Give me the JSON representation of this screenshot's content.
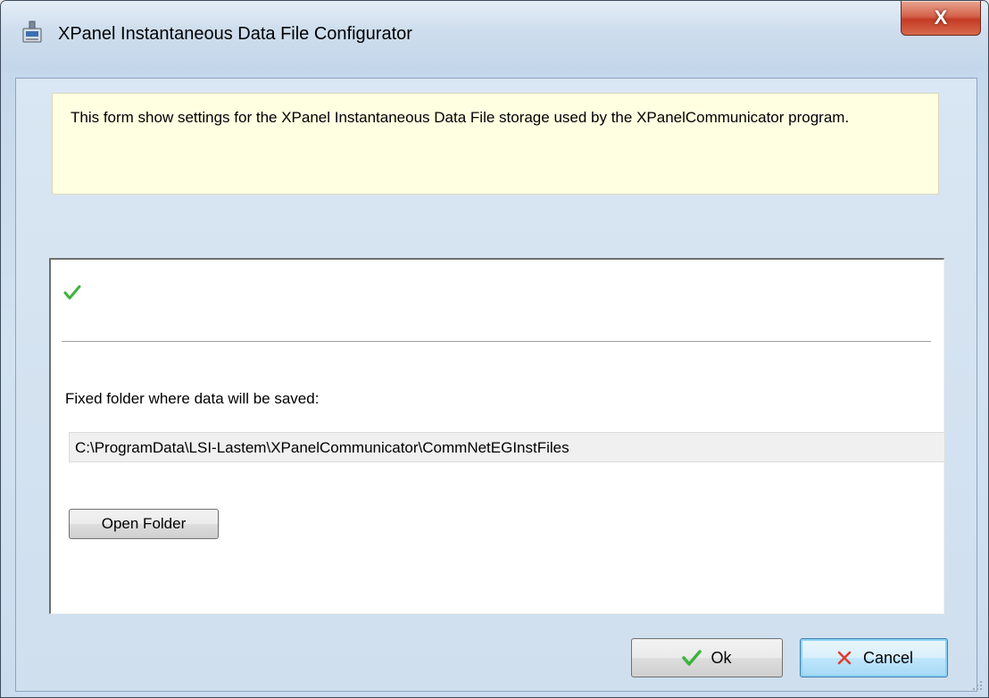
{
  "window": {
    "title": "XPanel Instantaneous Data File Configurator",
    "close_label": "X"
  },
  "info": {
    "text": "This form show settings for the XPanel Instantaneous Data File storage used by the XPanelCommunicator program."
  },
  "panel": {
    "status_icon": "checkmark-icon",
    "folder_label": "Fixed folder where data will be saved:",
    "folder_path": "C:\\ProgramData\\LSI-Lastem\\XPanelCommunicator\\CommNetEGInstFiles",
    "open_folder_label": "Open Folder"
  },
  "footer": {
    "ok_label": "Ok",
    "cancel_label": "Cancel"
  },
  "colors": {
    "info_background": "#ffffe1",
    "check_green": "#3cb43c",
    "cancel_red": "#e23c2c",
    "close_red": "#c43b25"
  }
}
